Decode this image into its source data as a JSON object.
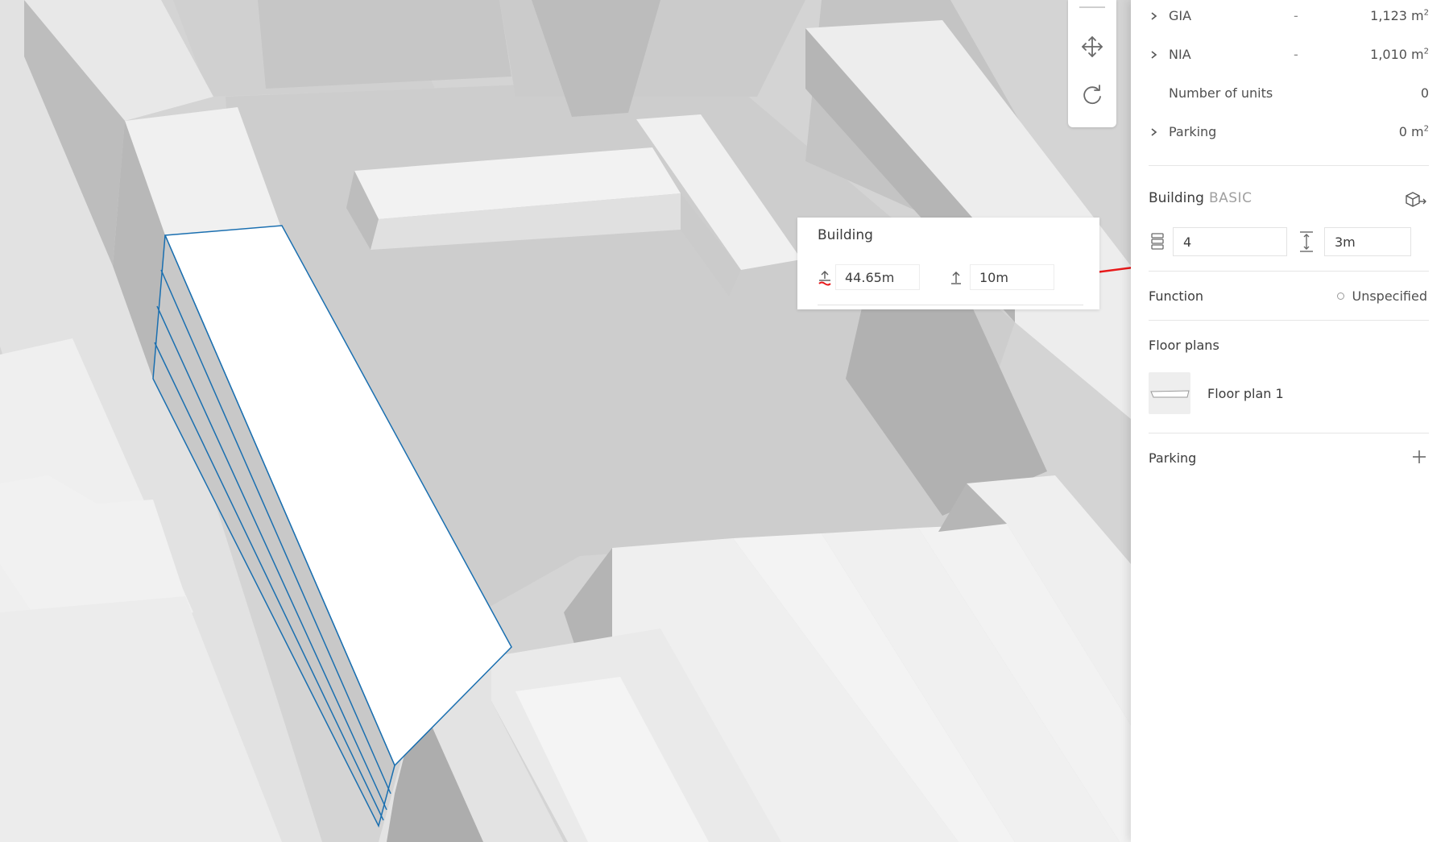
{
  "toolbar": {
    "tools": [
      {
        "name": "move-tool",
        "icon": "move-arrows-icon"
      },
      {
        "name": "rotate-tool",
        "icon": "rotate-icon"
      }
    ]
  },
  "popup": {
    "title": "Building",
    "base_elevation": "44.65m",
    "height": "10m",
    "icons": [
      "ground-elevation-icon",
      "height-up-icon"
    ]
  },
  "panel": {
    "metrics": [
      {
        "label": "GIA",
        "dash": "-",
        "value": "1,123 m",
        "unit_sup": "2",
        "expandable": true
      },
      {
        "label": "NIA",
        "dash": "-",
        "value": "1,010 m",
        "unit_sup": "2",
        "expandable": true
      },
      {
        "label": "Number of units",
        "dash": "",
        "value": "0",
        "unit_sup": "",
        "expandable": false
      },
      {
        "label": "Parking",
        "dash": "",
        "value": "0 m",
        "unit_sup": "2",
        "expandable": true
      }
    ],
    "building": {
      "title": "Building",
      "badge": "BASIC",
      "floors": "4",
      "floor_height": "3m",
      "icons": [
        "export-cube-icon",
        "floors-stack-icon",
        "floor-height-icon"
      ]
    },
    "function": {
      "label": "Function",
      "value": "Unspecified"
    },
    "floor_plans": {
      "title": "Floor plans",
      "items": [
        {
          "label": "Floor plan 1"
        }
      ]
    },
    "parking": {
      "title": "Parking",
      "icon": "plus-icon"
    }
  },
  "colors": {
    "accent_blue": "#1a6fb0",
    "annotation_red": "#e8191a",
    "panel_bg": "#ffffff",
    "ground": "#cfcfcf"
  }
}
